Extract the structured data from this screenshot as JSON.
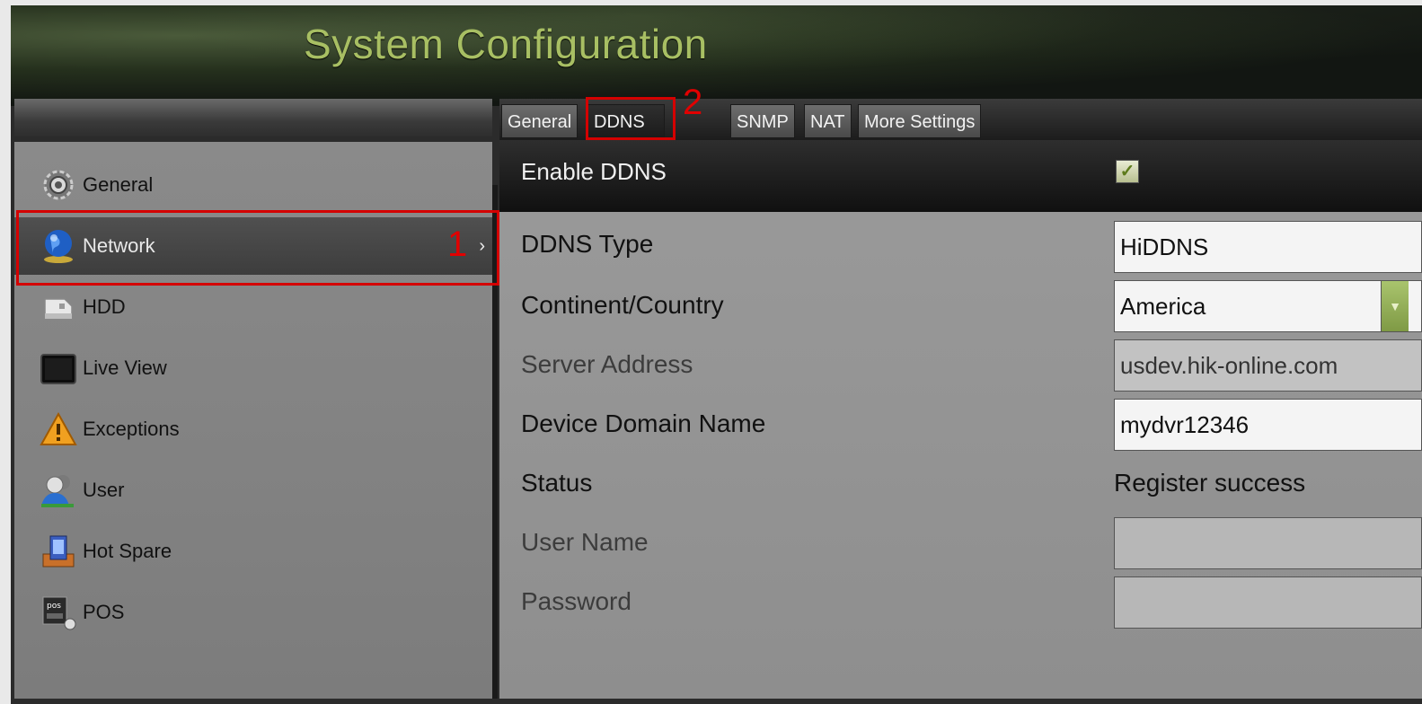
{
  "header": {
    "title": "System Configuration"
  },
  "sidebar": {
    "items": [
      {
        "label": "General",
        "icon": "gear-icon"
      },
      {
        "label": "Network",
        "icon": "globe-icon",
        "active": true
      },
      {
        "label": "HDD",
        "icon": "hdd-icon"
      },
      {
        "label": "Live View",
        "icon": "monitor-icon"
      },
      {
        "label": "Exceptions",
        "icon": "warning-icon"
      },
      {
        "label": "User",
        "icon": "user-icon"
      },
      {
        "label": "Hot Spare",
        "icon": "hot-spare-icon"
      },
      {
        "label": "POS",
        "icon": "pos-icon"
      }
    ],
    "active_chevron": "›"
  },
  "tabs": [
    {
      "label": "General"
    },
    {
      "label": "DDNS",
      "active": true
    },
    {
      "label": "SNMP"
    },
    {
      "label": "NAT"
    },
    {
      "label": "More Settings"
    }
  ],
  "annotations": {
    "step1": "1",
    "step2": "2"
  },
  "form": {
    "enable_label": "Enable DDNS",
    "enable_checked": "✓",
    "ddns_type_label": "DDNS Type",
    "ddns_type_value": "HiDDNS",
    "continent_label": "Continent/Country",
    "continent_value": "America",
    "server_label": "Server Address",
    "server_value": "usdev.hik-online.com",
    "domain_label": "Device Domain Name",
    "domain_value": "mydvr12346",
    "status_label": "Status",
    "status_value": "Register success",
    "username_label": "User Name",
    "username_value": "",
    "password_label": "Password",
    "password_value": ""
  },
  "colors": {
    "title": "#a8bf63",
    "annotation": "#d40000",
    "dropdown_accent": "#8fac52"
  }
}
